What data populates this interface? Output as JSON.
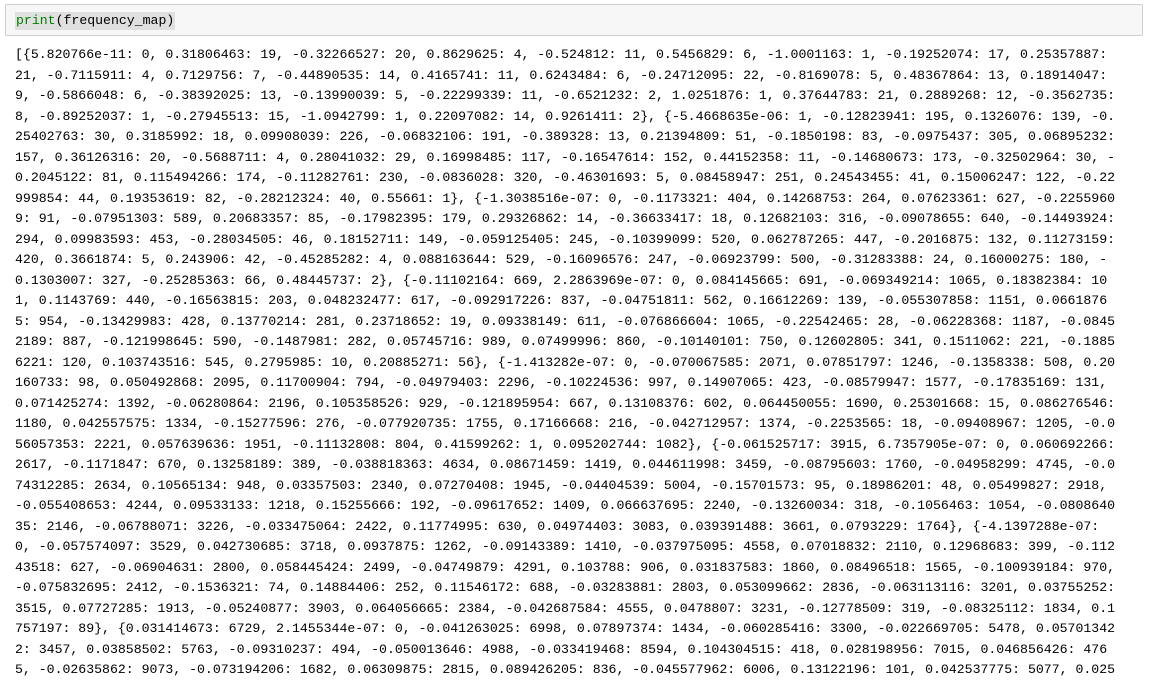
{
  "cell": {
    "code_func": "print",
    "code_args": "(frequency_map)"
  },
  "output": {
    "lines": [
      "[{5.820766e-11: 0, 0.31806463: 19, -0.32266527: 20, 0.8629625: 4, -0.524812: 11, 0.5456829: 6, -1.0001163: 1, -0.19252074: 17, 0.25357887:",
      "21, -0.7115911: 4, 0.7129756: 7, -0.44890535: 14, 0.4165741: 11, 0.6243484: 6, -0.24712095: 22, -0.8169078: 5, 0.48367864: 13, 0.18914047:",
      "9, -0.5866048: 6, -0.38392025: 13, -0.13990039: 5, -0.22299339: 11, -0.6521232: 2, 1.0251876: 1, 0.37644783: 21, 0.2889268: 12, -0.3562735:",
      "8, -0.89252037: 1, -0.27945513: 15, -1.0942799: 1, 0.22097082: 14, 0.9261411: 2}, {-5.4668635e-06: 1, -0.12823941: 195, 0.1326076: 139, -0.",
      "25402763: 30, 0.3185992: 18, 0.09908039: 226, -0.06832106: 191, -0.389328: 13, 0.21394809: 51, -0.1850198: 83, -0.0975437: 305, 0.06895232:",
      "157, 0.36126316: 20, -0.5688711: 4, 0.28041032: 29, 0.16998485: 117, -0.16547614: 152, 0.44152358: 11, -0.14680673: 173, -0.32502964: 30, -",
      "0.2045122: 81, 0.115494266: 174, -0.11282761: 230, -0.0836028: 320, -0.46301693: 5, 0.08458947: 251, 0.24543455: 41, 0.15006247: 122, -0.22",
      "999854: 44, 0.19353619: 82, -0.28212324: 40, 0.55661: 1}, {-1.3038516e-07: 0, -0.1173321: 404, 0.14268753: 264, 0.07623361: 627, -0.2255960",
      "9: 91, -0.07951303: 589, 0.20683357: 85, -0.17982395: 179, 0.29326862: 14, -0.36633417: 18, 0.12682103: 316, -0.09078655: 640, -0.14493924:",
      "294, 0.09983593: 453, -0.28034505: 46, 0.18152711: 149, -0.059125405: 245, -0.10399099: 520, 0.062787265: 447, -0.2016875: 132, 0.11273159:",
      "420, 0.3661874: 5, 0.243906: 42, -0.45285282: 4, 0.088163644: 529, -0.16096576: 247, -0.06923799: 500, -0.31283388: 24, 0.16000275: 180, -",
      "0.1303007: 327, -0.25285363: 66, 0.48445737: 2}, {-0.11102164: 669, 2.2863969e-07: 0, 0.084145665: 691, -0.069349214: 1065, 0.18382384: 10",
      "1, 0.1143769: 440, -0.16563815: 203, 0.048232477: 617, -0.092917226: 837, -0.04751811: 562, 0.16612269: 139, -0.055307858: 1151, 0.0661876",
      "5: 954, -0.13429983: 428, 0.13770214: 281, 0.23718652: 19, 0.09338149: 611, -0.076866604: 1065, -0.22542465: 28, -0.06228368: 1187, -0.0845",
      "2189: 887, -0.121998645: 590, -0.1487981: 282, 0.05745716: 989, 0.07499996: 860, -0.10140101: 750, 0.12602805: 341, 0.1511062: 221, -0.1885",
      "6221: 120, 0.103743516: 545, 0.2795985: 10, 0.20885271: 56}, {-1.413282e-07: 0, -0.070067585: 2071, 0.07851797: 1246, -0.1358338: 508, 0.20",
      "160733: 98, 0.050492868: 2095, 0.11700904: 794, -0.04979403: 2296, -0.10224536: 997, 0.14907065: 423, -0.08579947: 1577, -0.17835169: 131,",
      "0.071425274: 1392, -0.06280864: 2196, 0.105358526: 929, -0.121895954: 667, 0.13108376: 602, 0.064450055: 1690, 0.25301668: 15, 0.086276546:",
      "1180, 0.042557575: 1334, -0.15277596: 276, -0.077920735: 1755, 0.17166668: 216, -0.042712957: 1374, -0.2253565: 18, -0.09408967: 1205, -0.0",
      "56057353: 2221, 0.057639636: 1951, -0.11132808: 804, 0.41599262: 1, 0.095202744: 1082}, {-0.061525717: 3915, 6.7357905e-07: 0, 0.060692266:",
      "2617, -0.1171847: 670, 0.13258189: 389, -0.038818363: 4634, 0.08671459: 1419, 0.044611998: 3459, -0.08795603: 1760, -0.04958299: 4745, -0.0",
      "74312285: 2634, 0.10565134: 948, 0.03357503: 2340, 0.07270408: 1945, -0.04404539: 5004, -0.15701573: 95, 0.18986201: 48, 0.05499827: 2918,",
      "-0.055408653: 4244, 0.09533133: 1218, 0.15255666: 192, -0.09617652: 1409, 0.066637695: 2240, -0.13260034: 318, -0.1056463: 1054, -0.0808640",
      "35: 2146, -0.06788071: 3226, -0.033475064: 2422, 0.11774995: 630, 0.04974403: 3083, 0.039391488: 3661, 0.0793229: 1764}, {-4.1397288e-07:",
      "0, -0.057574097: 3529, 0.042730685: 3718, 0.0937875: 1262, -0.09143389: 1410, -0.037975095: 4558, 0.07018832: 2110, 0.12968683: 399, -0.112",
      "43518: 627, -0.06904631: 2800, 0.058445424: 2499, -0.04749879: 4291, 0.103788: 906, 0.031837583: 1860, 0.08496518: 1565, -0.100939184: 970,",
      "-0.075832695: 2412, -0.1536321: 74, 0.14884406: 252, 0.11546172: 688, -0.03283881: 2803, 0.053099662: 2836, -0.063113116: 3201, 0.03755252:",
      "3515, 0.07727285: 1913, -0.05240877: 3903, 0.064056665: 2384, -0.042687584: 4555, 0.0478807: 3231, -0.12778509: 319, -0.08325112: 1834, 0.1",
      "757197: 89}, {0.031414673: 6729, 2.1455344e-07: 0, -0.041263025: 6998, 0.07897374: 1434, -0.060285416: 3300, -0.022669705: 5478, 0.05701342",
      "2: 3457, 0.03858502: 5763, -0.09310237: 494, -0.050013646: 4988, -0.033419468: 8594, 0.104304515: 418, 0.028198956: 7015, 0.046856426: 476",
      "5, -0.02635862: 9073, -0.073194206: 1682, 0.06309875: 2815, 0.089426205: 836, -0.045577962: 6006, 0.13122196: 101, 0.042537775: 5077, 0.025"
    ]
  }
}
